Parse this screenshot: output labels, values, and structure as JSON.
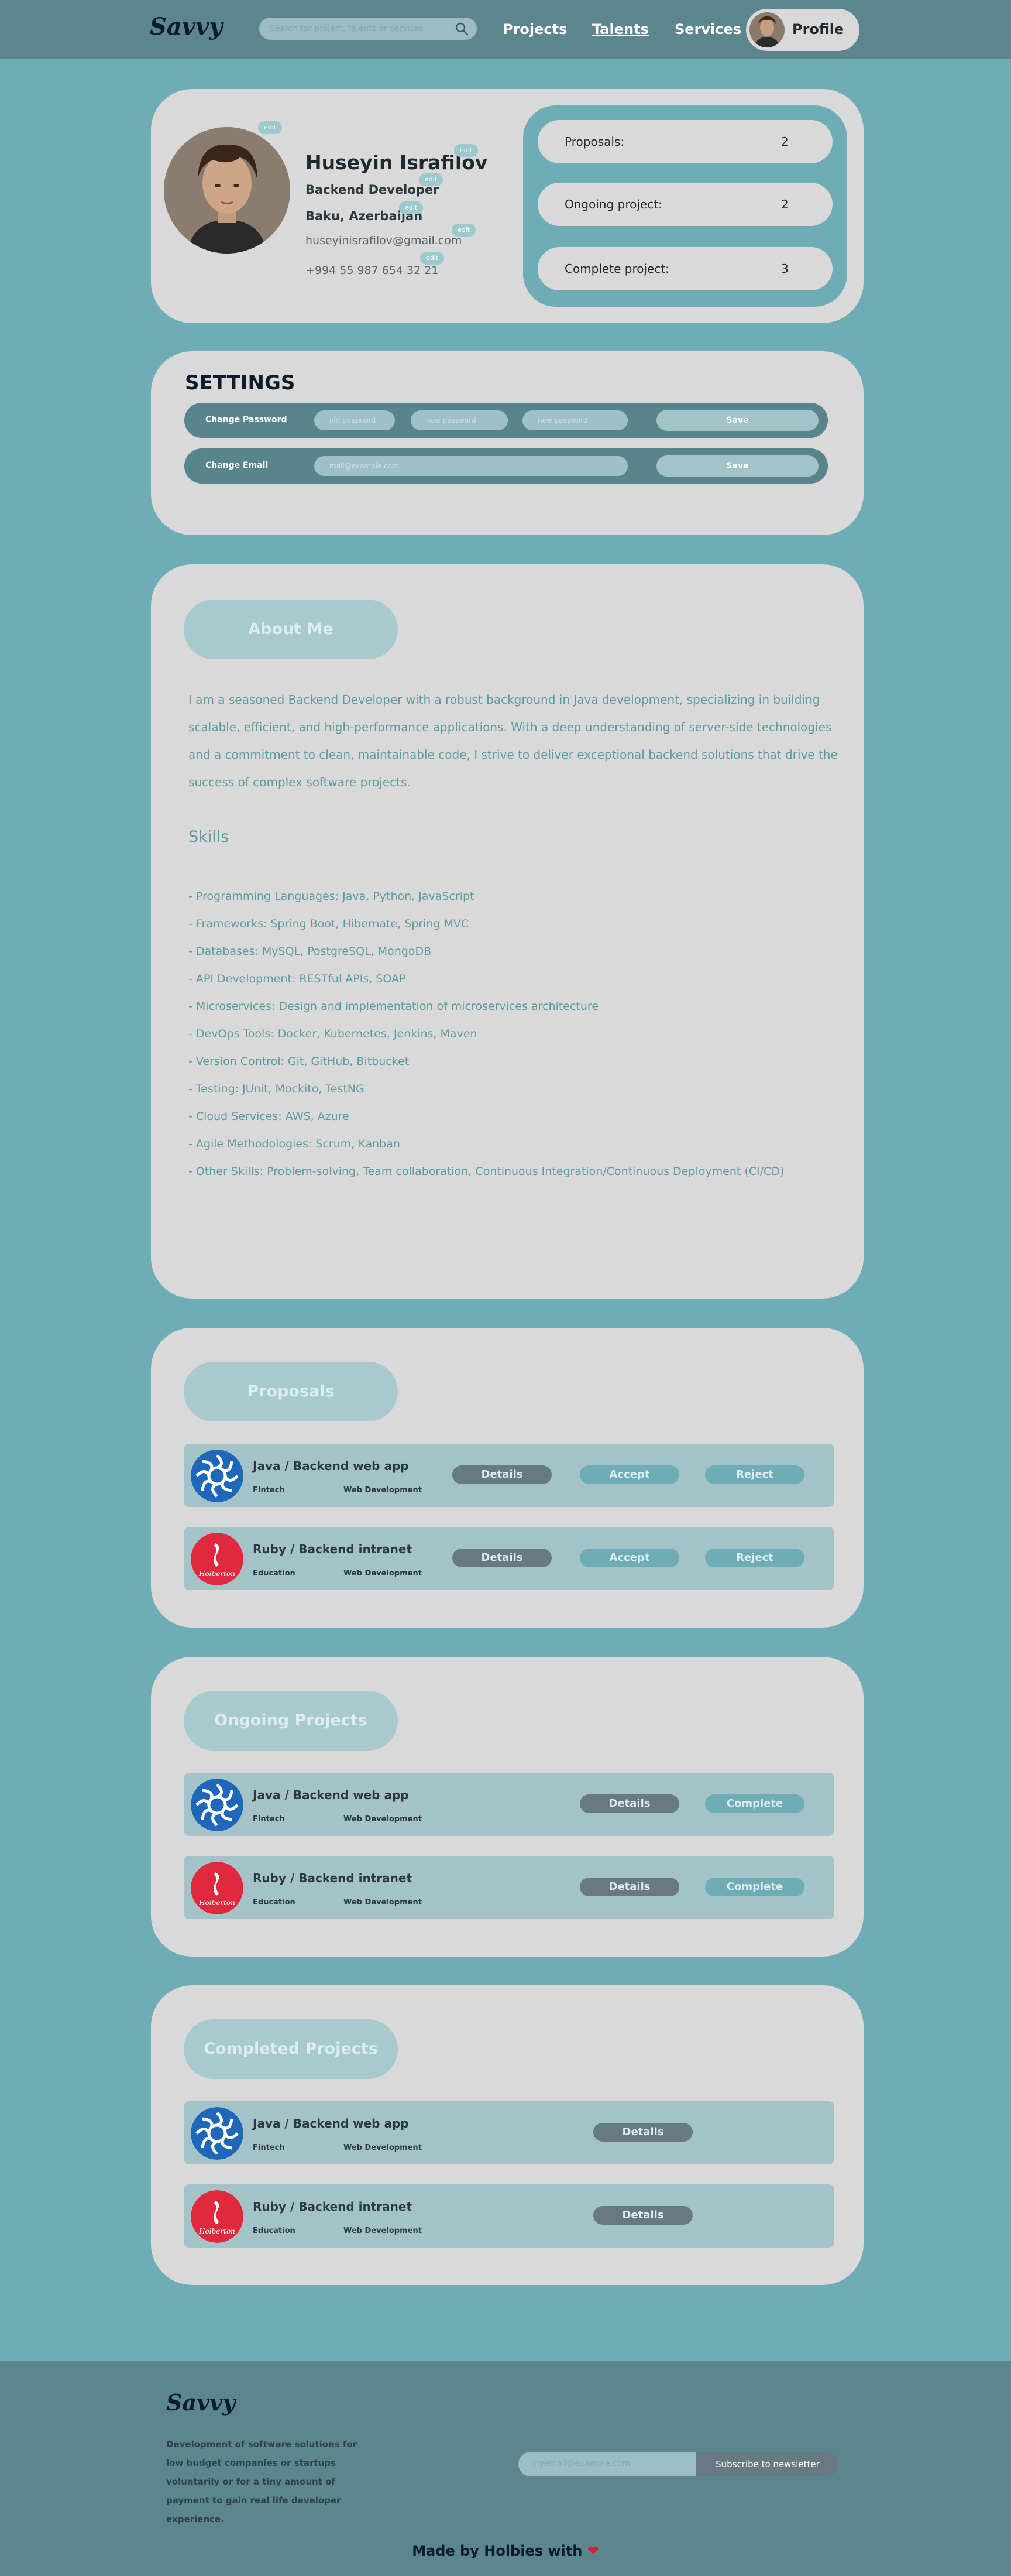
{
  "nav": {
    "logo": "Savvy",
    "search_placeholder": "Search for project, talents or services",
    "links": [
      "Projects",
      "Talents",
      "Services"
    ],
    "active_link": "Talents",
    "profile_label": "Profile"
  },
  "profile": {
    "name": "Huseyin Israfilov",
    "role": "Backend Developer",
    "location": "Baku, Azerbaijan",
    "email": "huseyinisrafilov@gmail.com",
    "phone": "+994 55 987 654 32 21",
    "edit_label": "edit",
    "stats": [
      {
        "label": "Proposals:",
        "value": "2"
      },
      {
        "label": "Ongoing project:",
        "value": "2"
      },
      {
        "label": "Complete project:",
        "value": "3"
      }
    ]
  },
  "settings": {
    "title": "SETTINGS",
    "password_label": "Change Password",
    "old_password_ph": "old password",
    "new_password_ph": "new password",
    "new_password_ph2": "new password",
    "email_label": "Change Email",
    "email_ph": "mail@example.com",
    "save_label": "Save"
  },
  "about": {
    "heading": "About Me",
    "text": "I am a seasoned Backend Developer with a robust background in Java development, specializing in building scalable, efficient, and high-performance applications. With a deep understanding of server-side technologies and a commitment to clean, maintainable code, I strive to deliver exceptional backend solutions that drive the success of complex software projects.",
    "skills_heading": "Skills",
    "skills": [
      "- Programming Languages: Java, Python, JavaScript",
      "- Frameworks: Spring Boot, Hibernate, Spring MVC",
      "- Databases: MySQL, PostgreSQL, MongoDB",
      "- API Development: RESTful APIs, SOAP",
      "- Microservices: Design and implementation of microservices architecture",
      "- DevOps Tools: Docker, Kubernetes, Jenkins, Maven",
      "- Version Control: Git, GitHub, Bitbucket",
      "- Testing: JUnit, Mockito, TestNG",
      "- Cloud Services: AWS, Azure",
      "- Agile Methodologies: Scrum, Kanban",
      "- Other Skills: Problem-solving, Team collaboration, Continuous Integration/Continuous Deployment (CI/CD)"
    ]
  },
  "buttons": {
    "details": "Details",
    "accept": "Accept",
    "reject": "Reject",
    "complete": "Complete"
  },
  "proposals": {
    "heading": "Proposals",
    "items": [
      {
        "title": "Java / Backend web app",
        "category": "Fintech",
        "type": "Web Development"
      },
      {
        "title": "Ruby / Backend intranet",
        "category": "Education",
        "type": "Web Development"
      }
    ]
  },
  "ongoing": {
    "heading": "Ongoing Projects",
    "items": [
      {
        "title": "Java / Backend web app",
        "category": "Fintech",
        "type": "Web Development"
      },
      {
        "title": "Ruby / Backend intranet",
        "category": "Education",
        "type": "Web Development"
      }
    ]
  },
  "completed": {
    "heading": "Completed Projects",
    "items": [
      {
        "title": "Java / Backend web app",
        "category": "Fintech",
        "type": "Web Development"
      },
      {
        "title": "Ruby / Backend intranet",
        "category": "Education",
        "type": "Web Development"
      }
    ]
  },
  "logo_brand": "Holberton",
  "footer": {
    "logo": "Savvy",
    "description": "Development of software solutions for low budget companies or startups voluntarily or for a tiny amount of payment to gain real life developer experience.",
    "newsletter_ph": "myemail@example.com",
    "subscribe_label": "Subscribe to newsletter",
    "made_by": "Made by Holbies with",
    "heart": "❤"
  },
  "colors": {
    "page_bg": "#6fadb6",
    "nav_bg": "#5b868d",
    "card_bg": "#d9d9d9",
    "accent_teal": "#6fadb6",
    "button_dark": "#677a81"
  }
}
